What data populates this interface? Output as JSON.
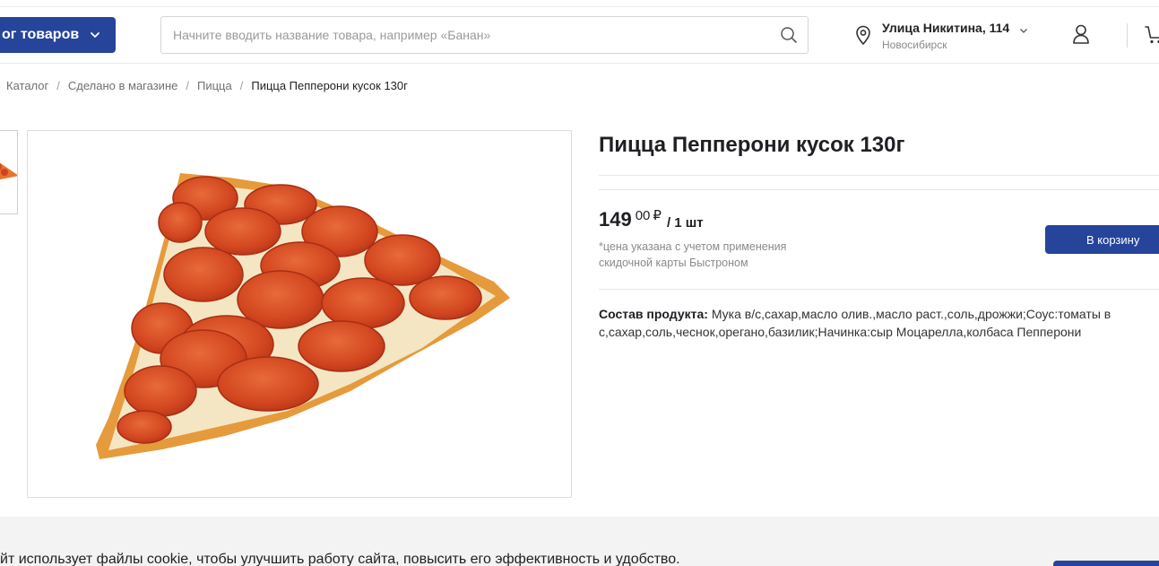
{
  "header": {
    "catalog_button": "ог товаров",
    "search": {
      "placeholder": "Начните вводить название товара, например «Банан»"
    },
    "location": {
      "street": "Улица Никитина, 114",
      "city": "Новосибирск"
    }
  },
  "breadcrumb": [
    {
      "label": "Каталог"
    },
    {
      "label": "Сделано в магазине"
    },
    {
      "label": "Пицца"
    },
    {
      "label": "Пицца Пепперони кусок 130г"
    }
  ],
  "breadcrumb_separator": "/",
  "product": {
    "title": "Пицца Пепперони кусок 130г",
    "price": {
      "rubles": "149",
      "kopecks": "00",
      "currency": "₽",
      "unit": "/ 1 шт"
    },
    "price_note": "*цена указана с учетом применения скидочной карты Быстроном",
    "add_to_cart": "В корзину",
    "composition_label": "Состав продукта:",
    "composition_text": " Мука в/с,сахар,масло олив.,масло раст.,соль,дрожжи;Соус:томаты в с,сахар,соль,чеснок,орегано,базилик;Начинка:сыр Моцарелла,колбаса Пепперони"
  },
  "cookie_banner": {
    "text": "йт использует файлы cookie, чтобы улучшить работу сайта, повысить его эффективность и удобство."
  },
  "colors": {
    "accent": "#26449a",
    "divider": "#e6e6e6",
    "muted_text": "#8a8a8a"
  },
  "icons": {
    "catalog_chevron": "chevron-down-icon",
    "search": "search-icon",
    "location": "map-pin-icon",
    "location_dropdown": "chevron-down-icon",
    "account": "user-icon",
    "cart": "cart-icon"
  }
}
